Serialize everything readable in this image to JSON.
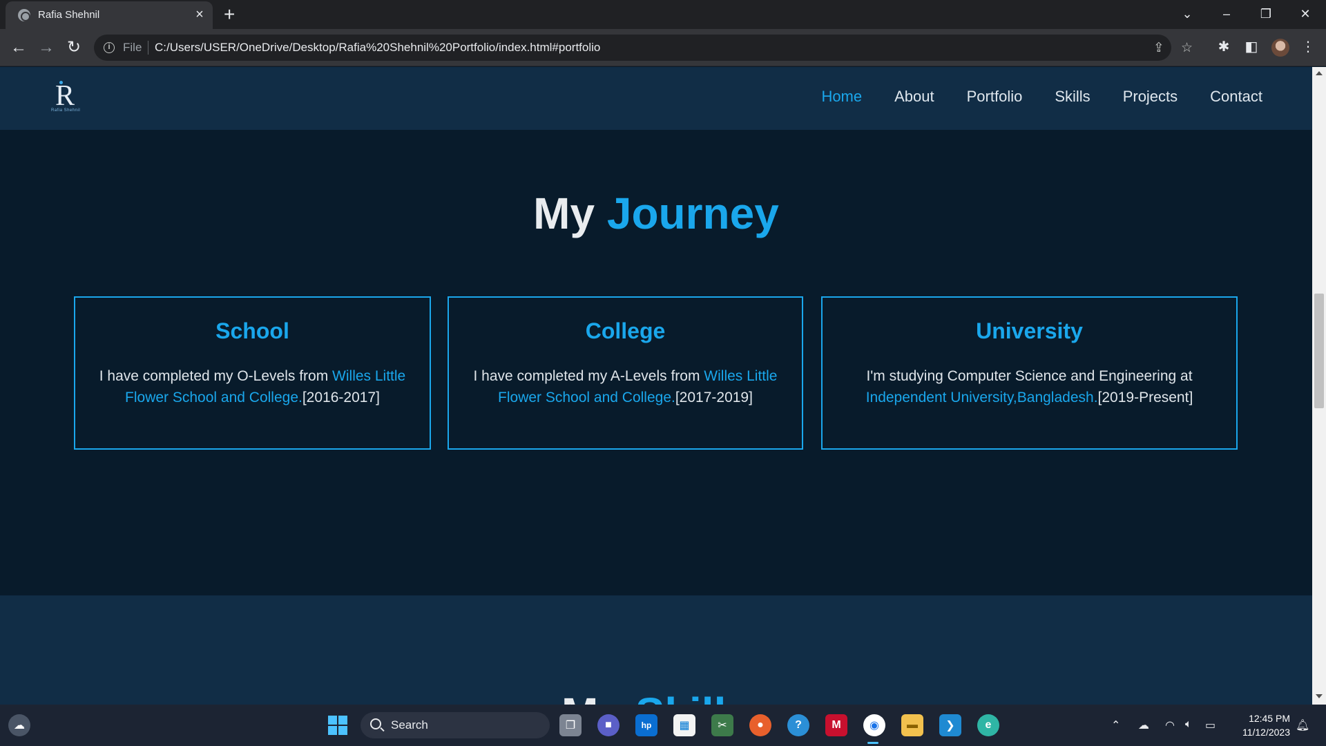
{
  "browser": {
    "tab_title": "Rafia Shehnil",
    "omnibox_scheme": "File",
    "url": "C:/Users/USER/OneDrive/Desktop/Rafia%20Shehnil%20Portfolio/index.html#portfolio"
  },
  "site": {
    "logo_letter": "R",
    "logo_sub": "Rafia Shehnil",
    "nav": [
      {
        "label": "Home",
        "active": true
      },
      {
        "label": "About",
        "active": false
      },
      {
        "label": "Portfolio",
        "active": false
      },
      {
        "label": "Skills",
        "active": false
      },
      {
        "label": "Projects",
        "active": false
      },
      {
        "label": "Contact",
        "active": false
      }
    ]
  },
  "journey": {
    "title_lead": "My",
    "title_accent": "Journey",
    "cards": [
      {
        "title": "School",
        "text_before": "I have completed my O-Levels from ",
        "link": "Willes Little Flower School and College.",
        "text_after": "[2016-2017]"
      },
      {
        "title": "College",
        "text_before": "I have completed my A-Levels from ",
        "link": "Willes Little Flower School and College.",
        "text_after": "[2017-2019]"
      },
      {
        "title": "University",
        "text_before": "I'm studying Computer Science and Engineering at ",
        "link": "Independent University,Bangladesh.",
        "text_after": "[2019-Present]"
      }
    ]
  },
  "skills": {
    "title_lead": "My",
    "title_accent": "Skills"
  },
  "taskbar": {
    "search_label": "Search",
    "time": "12:45 PM",
    "date": "11/12/2023"
  },
  "colors": {
    "accent": "#1aa7ec",
    "header_bg": "#112d46",
    "section_bg": "#081b2b"
  }
}
